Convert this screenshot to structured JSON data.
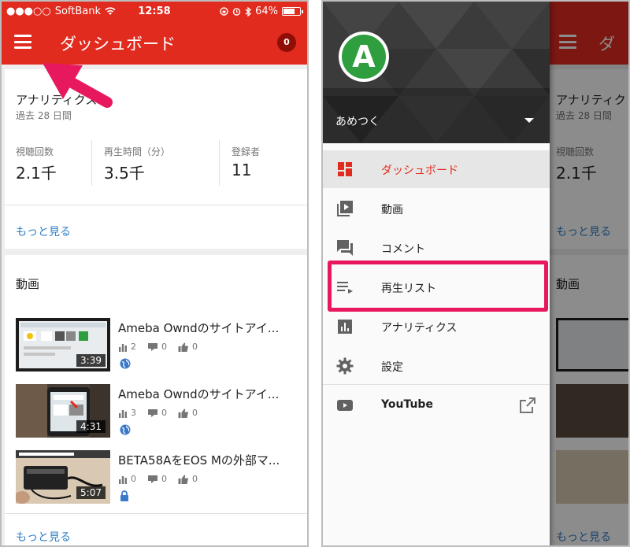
{
  "status_bar": {
    "carrier": "SoftBank",
    "time": "12:58",
    "battery": "64%"
  },
  "app_bar": {
    "title": "ダッシュボード",
    "notification_count": "0"
  },
  "analytics_card": {
    "title": "アナリティクス",
    "period": "過去 28 日間",
    "stats": [
      {
        "label": "視聴回数",
        "value": "2.1千"
      },
      {
        "label": "再生時間（分）",
        "value": "3.5千"
      },
      {
        "label": "登録者",
        "value": "11"
      }
    ],
    "more_link": "もっと見る"
  },
  "videos_card": {
    "title": "動画",
    "items": [
      {
        "title": "Ameba Owndのサイトアイ...",
        "duration": "3:39",
        "views": "2",
        "comments": "0",
        "likes": "0",
        "privacy": "globe-icon"
      },
      {
        "title": "Ameba Owndのサイトアイ...",
        "duration": "4:31",
        "views": "3",
        "comments": "0",
        "likes": "0",
        "privacy": "globe-icon"
      },
      {
        "title": "BETA58AをEOS Mの外部マ...",
        "duration": "5:07",
        "views": "0",
        "comments": "0",
        "likes": "0",
        "privacy": "lock-icon"
      }
    ],
    "more_link": "もっと見る"
  },
  "drawer": {
    "account_name": "あめつく",
    "avatar_letter": "A",
    "items": [
      {
        "label": "ダッシュボード",
        "icon": "dashboard-icon",
        "active": true
      },
      {
        "label": "動画",
        "icon": "video-library-icon"
      },
      {
        "label": "コメント",
        "icon": "comment-icon"
      },
      {
        "label": "再生リスト",
        "icon": "playlist-icon"
      },
      {
        "label": "アナリティクス",
        "icon": "analytics-icon"
      },
      {
        "label": "設定",
        "icon": "gear-icon"
      },
      {
        "label": "YouTube",
        "icon": "youtube-icon",
        "external": true
      }
    ]
  },
  "background_screen": {
    "analytics_title": "アナリティク",
    "period": "過去 28 日間",
    "stat_label": "視聴回数",
    "stat_value": "2.1千",
    "more_link": "もっと見る",
    "videos_title": "動画",
    "more_link_bottom": "もっと見る"
  },
  "colors": {
    "brand_red": "#e22b1f",
    "link_blue": "#2f7ec4",
    "highlight_pink": "#e8185f",
    "avatar_green": "#2f9e3f"
  }
}
